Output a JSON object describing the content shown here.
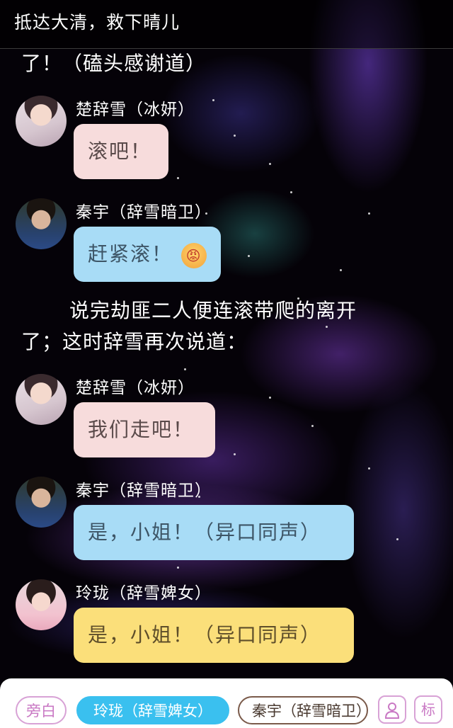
{
  "header": {
    "title": "抵达大清，救下晴儿"
  },
  "narration_1": "了！（磕头感谢道）",
  "messages": [
    {
      "speaker": "楚辞雪（冰妍）",
      "text": "滚吧！",
      "emoji": ""
    },
    {
      "speaker": "秦宇（辞雪暗卫）",
      "text": "赶紧滚！",
      "emoji": "😡"
    },
    {
      "speaker": "楚辞雪（冰妍）",
      "text": "我们走吧！",
      "emoji": ""
    },
    {
      "speaker": "秦宇（辞雪暗卫）",
      "text": "是，小姐！（异口同声）",
      "emoji": ""
    },
    {
      "speaker": "玲珑（辞雪婢女）",
      "text": "是，小姐！（异口同声）",
      "emoji": ""
    }
  ],
  "narration_2": {
    "line1": "说完劫匪二人便连滚带爬的离开",
    "line2": "了；这时辞雪再次说道："
  },
  "bottom_bar": {
    "narrator_label": "旁白",
    "selected_character": "玲珑（辞雪婢女）",
    "other_character": "秦宇（辞雪暗卫）",
    "user_icon": "user-icon",
    "mark_label": "标"
  },
  "colors": {
    "bubble_pink": "#f7dcdc",
    "bubble_blue": "#a8dcf6",
    "bubble_yellow": "#fbdf7a",
    "selected_chip": "#3ac0ef"
  }
}
